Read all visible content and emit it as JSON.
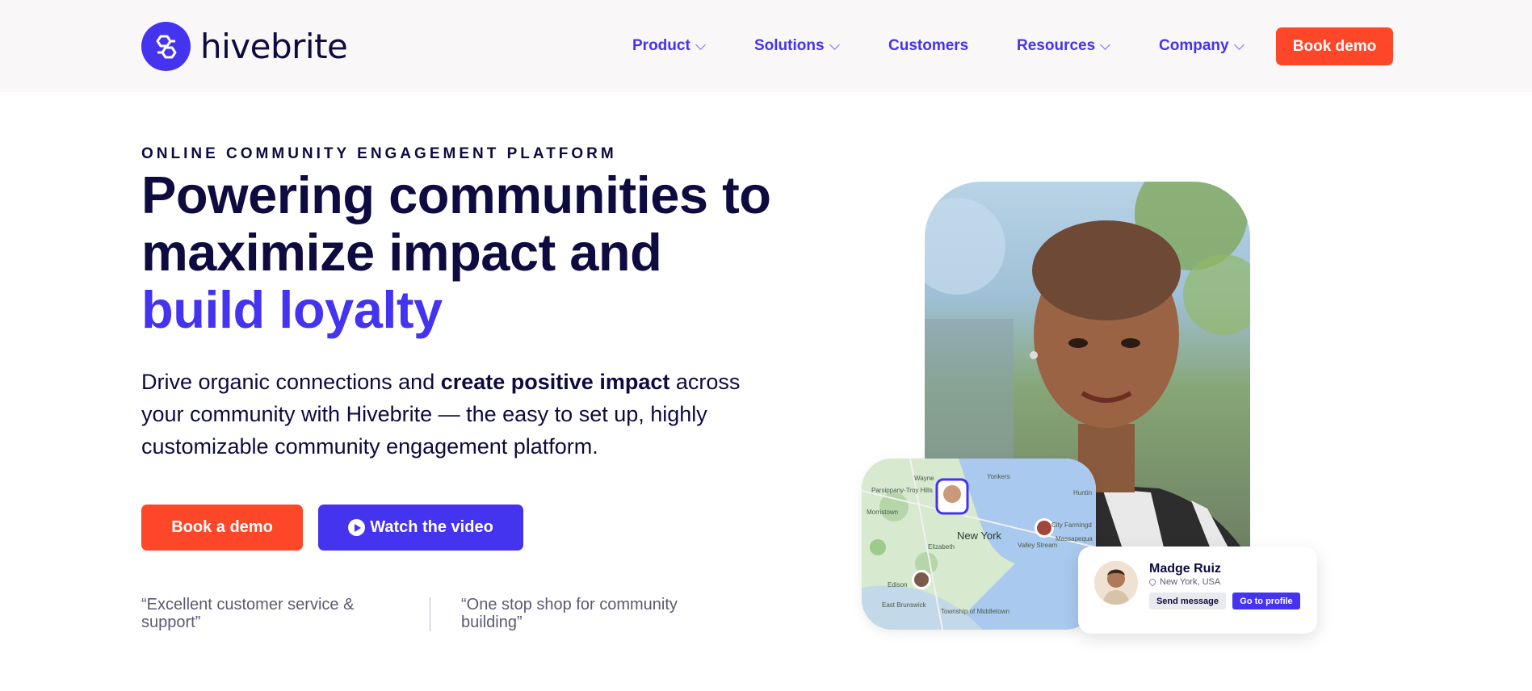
{
  "header": {
    "logo_text": "hivebrite",
    "nav": [
      {
        "label": "Product",
        "dropdown": true
      },
      {
        "label": "Solutions",
        "dropdown": true
      },
      {
        "label": "Customers",
        "dropdown": false
      },
      {
        "label": "Resources",
        "dropdown": true
      },
      {
        "label": "Company",
        "dropdown": true
      }
    ],
    "cta_label": "Book demo"
  },
  "hero": {
    "eyebrow": "ONLINE COMMUNITY ENGAGEMENT PLATFORM",
    "headline_line1": "Powering communities to",
    "headline_line2": "maximize impact and",
    "headline_accent": "build loyalty",
    "desc_part1": "Drive organic connections and ",
    "desc_bold": "create positive impact",
    "desc_part2": " across your community with Hivebrite — the easy to set up, highly customizable community engagement platform.",
    "primary_button": "Book a demo",
    "secondary_button": "Watch the video",
    "quotes": [
      "“Excellent customer service & support”",
      "“One stop shop for community building”"
    ]
  },
  "map": {
    "labels": [
      "Wayne",
      "Yonkers",
      "Parsippany-Troy Hills",
      "Morristown",
      "New York",
      "City Farmingd",
      "Massapequa",
      "Valley Stream",
      "Elizabeth",
      "Edison",
      "East Brunswick",
      "Township of Middletown",
      "Huntin"
    ]
  },
  "profile_card": {
    "name": "Madge Ruiz",
    "location": "New York, USA",
    "send_button": "Send message",
    "profile_button": "Go to profile"
  },
  "colors": {
    "brand_purple": "#4433ef",
    "cta_orange": "#fe4728",
    "navy": "#0d0b3f",
    "header_bg": "#f9f7f7"
  },
  "icons": [
    "hivebrite-logo-icon",
    "chevron-down-icon",
    "play-icon",
    "location-pin-icon"
  ]
}
